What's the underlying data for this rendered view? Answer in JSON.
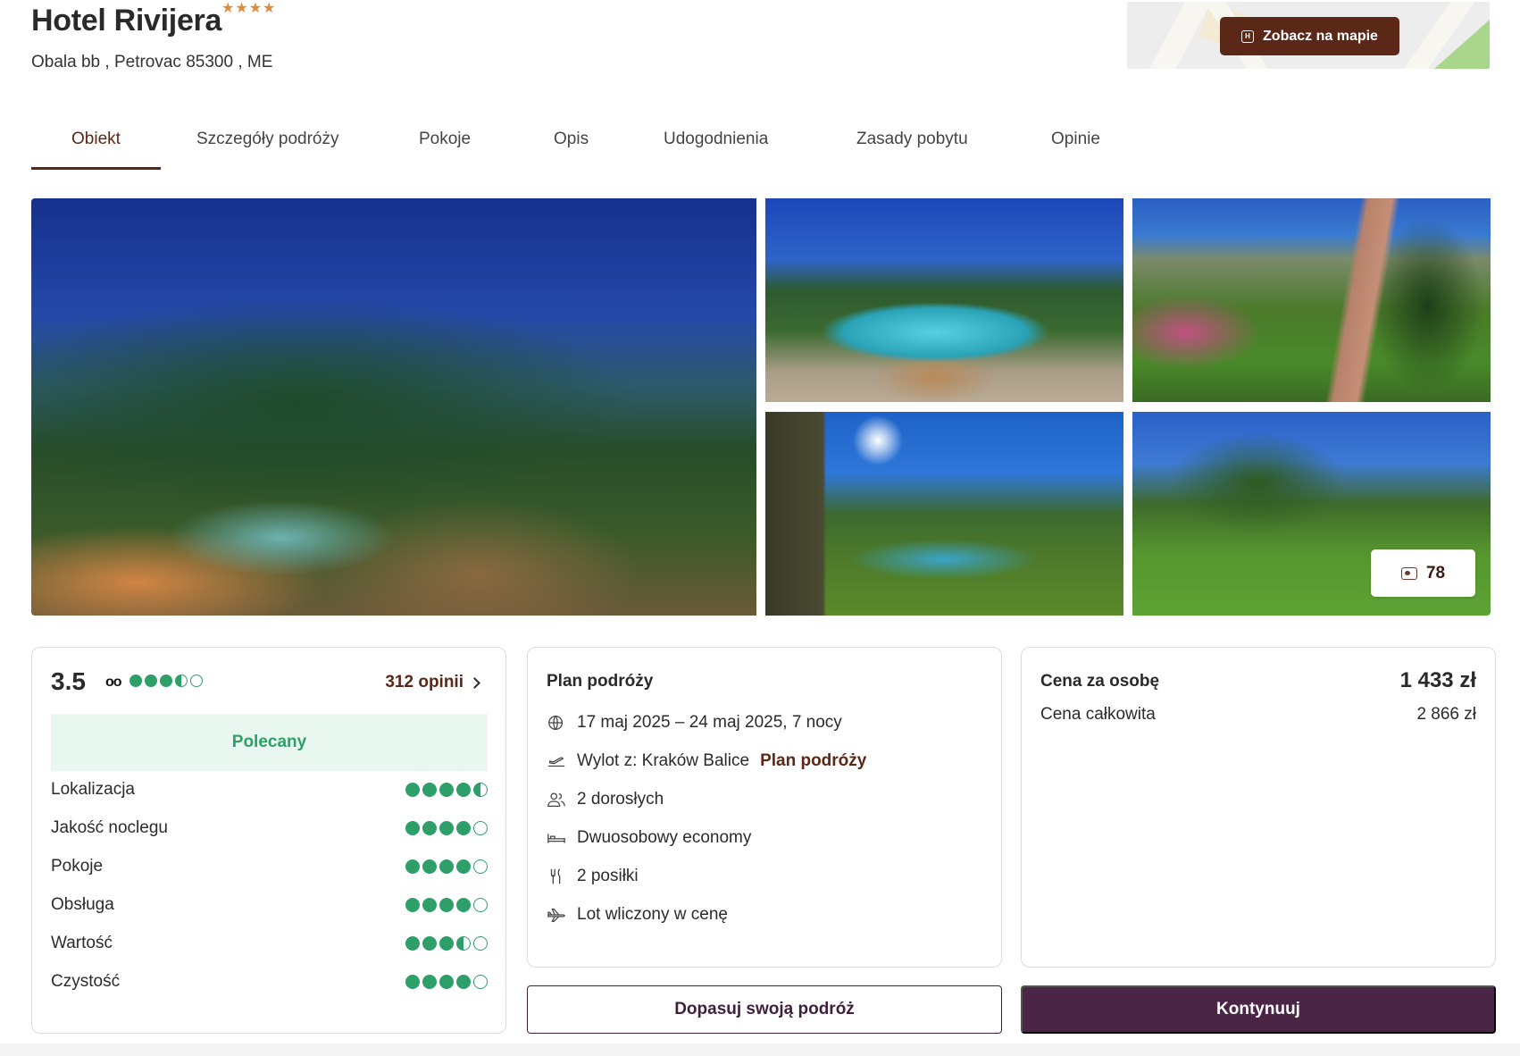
{
  "header": {
    "title": "Hotel Rivijera",
    "stars": "★★★★",
    "address": "Obala bb , Petrovac 85300 , ME",
    "map_button_label": "Zobacz na mapie"
  },
  "tabs": [
    {
      "label": "Obiekt",
      "active": true
    },
    {
      "label": "Szczegóły podróży"
    },
    {
      "label": "Pokoje"
    },
    {
      "label": "Opis"
    },
    {
      "label": "Udogodnienia"
    },
    {
      "label": "Zasady pobytu"
    },
    {
      "label": "Opinie"
    }
  ],
  "gallery": {
    "photo_count": "78"
  },
  "rating": {
    "score": "3.5",
    "tripadvisor_dots": 3.5,
    "reviews_link": "312 opinii",
    "recommended_label": "Polecany",
    "criteria": [
      {
        "label": "Lokalizacja",
        "value": 4.5
      },
      {
        "label": "Jakość noclegu",
        "value": 4
      },
      {
        "label": "Pokoje",
        "value": 4
      },
      {
        "label": "Obsługa",
        "value": 4
      },
      {
        "label": "Wartość",
        "value": 3.5
      },
      {
        "label": "Czystość",
        "value": 4
      }
    ],
    "accent_color": "#2f9f6a"
  },
  "plan": {
    "title": "Plan podróży",
    "rows": [
      {
        "icon": "calendar-globe-icon",
        "text": "17 maj 2025 – 24 maj 2025, 7 nocy"
      },
      {
        "icon": "plane-departure-icon",
        "text": "Wylot z: Kraków Balice",
        "link": "Plan podróży"
      },
      {
        "icon": "people-icon",
        "text": "2 dorosłych"
      },
      {
        "icon": "bed-icon",
        "text": "Dwuosobowy economy"
      },
      {
        "icon": "cutlery-icon",
        "text": "2 posiłki"
      },
      {
        "icon": "plane-icon",
        "text": "Lot wliczony w cenę"
      }
    ]
  },
  "price": {
    "per_person_label": "Cena za osobę",
    "per_person_value": "1 433 zł",
    "total_label": "Cena całkowita",
    "total_value": "2 866 zł"
  },
  "actions": {
    "adjust_label": "Dopasuj swoją podróż",
    "continue_label": "Kontynuuj"
  },
  "colors": {
    "brand_brown": "#5b2716",
    "brand_plum": "#4a2545",
    "star": "#e08a3c"
  }
}
